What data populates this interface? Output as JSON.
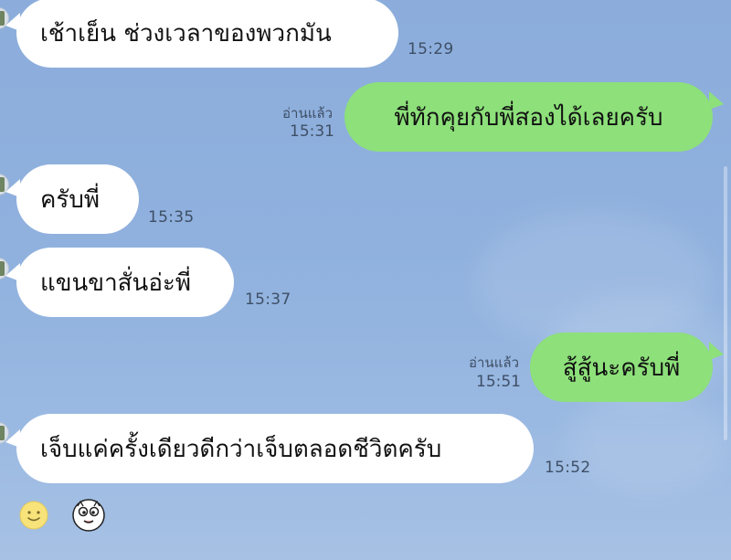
{
  "messages": [
    {
      "direction": "incoming",
      "text": "เช้าเย็น ช่วงเวลาของพวกมัน",
      "time": "15:29"
    },
    {
      "direction": "outgoing",
      "text": "พี่ทักคุยกับพี่สองได้เลยครับ",
      "read": "อ่านแล้ว",
      "time": "15:31"
    },
    {
      "direction": "incoming",
      "text": "ครับพี่",
      "time": "15:35"
    },
    {
      "direction": "incoming",
      "text": "แขนขาสั่นอ่ะพี่",
      "time": "15:37"
    },
    {
      "direction": "outgoing",
      "text": "สู้สู้นะครับพี่",
      "read": "อ่านแล้ว",
      "time": "15:51"
    },
    {
      "direction": "incoming",
      "text": "เจ็บแค่ครั้งเดียวดีกว่าเจ็บตลอดชีวิตครับ",
      "time": "15:52"
    }
  ],
  "colors": {
    "background": "#8fb0dd",
    "incoming_bubble": "#ffffff",
    "outgoing_bubble": "#8de07a",
    "meta_text": "#3e4f66"
  },
  "icons": {
    "emoji_button": "smiley-face-icon",
    "sticker_button": "character-sticker-icon"
  }
}
